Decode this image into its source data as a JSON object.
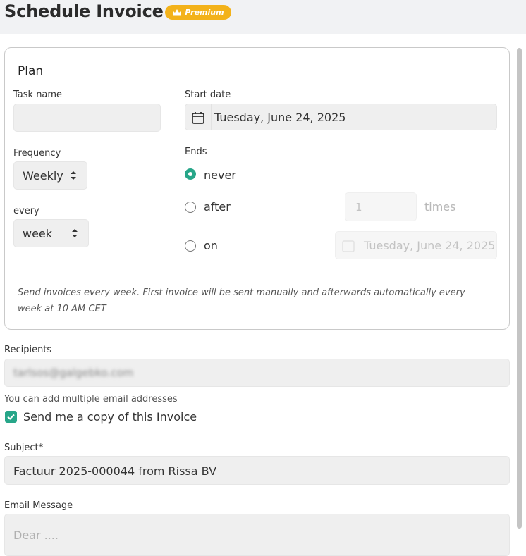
{
  "header": {
    "title": "Schedule Invoice",
    "badge": "Premium"
  },
  "plan": {
    "heading": "Plan",
    "task_name_label": "Task name",
    "task_name_value": "",
    "start_date_label": "Start date",
    "start_date_value": "Tuesday, June 24, 2025",
    "frequency_label": "Frequency",
    "frequency_value": "Weekly",
    "every_label": "every",
    "every_value": "week",
    "ends_label": "Ends",
    "ends_options": [
      "never",
      "after",
      "on"
    ],
    "ends_selected": "never",
    "after_count": "1",
    "after_unit": "times",
    "on_date": "Tuesday, June 24, 2025",
    "description": "Send invoices every week. First invoice will be sent manually and afterwards automatically every week at 10 AM CET"
  },
  "recipients": {
    "label": "Recipients",
    "value": "tarlsos@galgebko.com",
    "hint": "You can add multiple email addresses",
    "copy_label": "Send me a copy of this Invoice",
    "copy_checked": true
  },
  "subject": {
    "label": "Subject*",
    "value": "Factuur 2025-000044 from Rissa BV"
  },
  "message": {
    "label": "Email Message",
    "placeholder": "Dear ...."
  },
  "colors": {
    "accent": "#27a689",
    "badge": "#f3b21a"
  },
  "icons": [
    "crown-icon",
    "calendar-icon",
    "sort-arrows-icon",
    "checkmark-icon"
  ]
}
